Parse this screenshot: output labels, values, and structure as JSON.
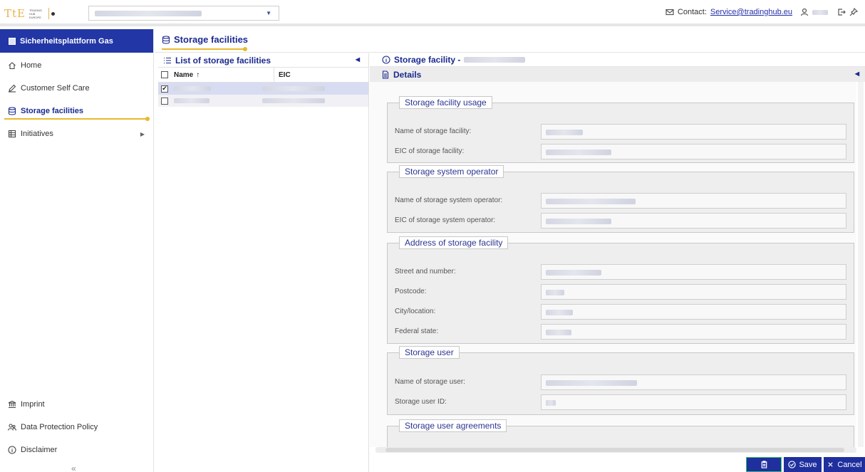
{
  "header": {
    "logo": {
      "mark": "TtE",
      "words": "TRADING HUB EUROPE",
      "partner": ""
    },
    "contact_label": "Contact:",
    "contact_email": "Service@tradinghub.eu"
  },
  "sidebar": {
    "title": "Sicherheitsplattform Gas",
    "items": [
      {
        "label": "Home",
        "icon": "home-icon"
      },
      {
        "label": "Customer Self Care",
        "icon": "edit-icon"
      },
      {
        "label": "Storage facilities",
        "icon": "database-icon",
        "active": true
      },
      {
        "label": "Initiatives",
        "icon": "list-icon",
        "has_submenu": true
      }
    ],
    "footer": [
      {
        "label": "Imprint",
        "icon": "bank-icon"
      },
      {
        "label": "Data Protection Policy",
        "icon": "people-icon"
      },
      {
        "label": "Disclaimer",
        "icon": "info-icon"
      }
    ],
    "collapse_glyph": "«"
  },
  "page": {
    "title": "Storage facilities"
  },
  "list": {
    "title": "List of storage facilities",
    "columns": {
      "name": "Name",
      "sort_glyph": "↑",
      "eic": "EIC"
    },
    "rows": [
      {
        "checked": true
      },
      {
        "checked": false
      }
    ]
  },
  "detail": {
    "title": "Storage facility -",
    "details_label": "Details",
    "groups": [
      {
        "legend": "Storage facility usage",
        "fields": [
          "Name of storage facility:",
          "EIC of storage facility:"
        ]
      },
      {
        "legend": "Storage system operator",
        "fields": [
          "Name of storage system operator:",
          "EIC of storage system operator:"
        ]
      },
      {
        "legend": "Address of storage facility",
        "fields": [
          "Street and number:",
          "Postcode:",
          "City/location:",
          "Federal state:"
        ]
      },
      {
        "legend": "Storage user",
        "fields": [
          "Name of storage user:",
          "Storage user ID:"
        ]
      },
      {
        "legend": "Storage user agreements",
        "fields": []
      }
    ]
  },
  "buttons": {
    "save": "Save",
    "cancel": "Cancel"
  },
  "colors": {
    "primary": "#2236a6",
    "accent": "#e8b92f",
    "clip_border": "#2fc46b"
  }
}
